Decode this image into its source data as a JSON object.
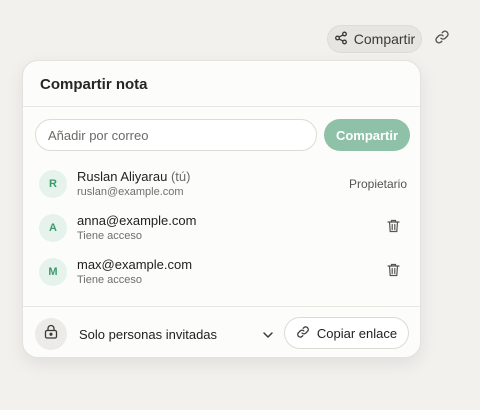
{
  "topbar": {
    "share_label": "Compartir",
    "share_icon": "share-icon",
    "link_icon": "link-icon"
  },
  "dialog": {
    "title": "Compartir nota",
    "email_input": {
      "placeholder": "Añadir por correo",
      "value": ""
    },
    "share_button": "Compartir",
    "accent_color": "#8fc1a8",
    "members": [
      {
        "initial": "R",
        "name": "Ruslan Aliyarau",
        "you_tag": "(tú)",
        "subtitle": "ruslan@example.com",
        "role": "Propietario"
      },
      {
        "initial": "A",
        "name": "anna@example.com",
        "subtitle": "Tiene acceso",
        "action_icon": "trash-icon"
      },
      {
        "initial": "M",
        "name": "max@example.com",
        "subtitle": "Tiene acceso",
        "action_icon": "trash-icon"
      }
    ],
    "access": {
      "icon": "lock-icon",
      "selected": "Solo personas invitadas",
      "chevron_icon": "chevron-down-icon"
    },
    "copy_link_button": "Copiar enlace"
  }
}
